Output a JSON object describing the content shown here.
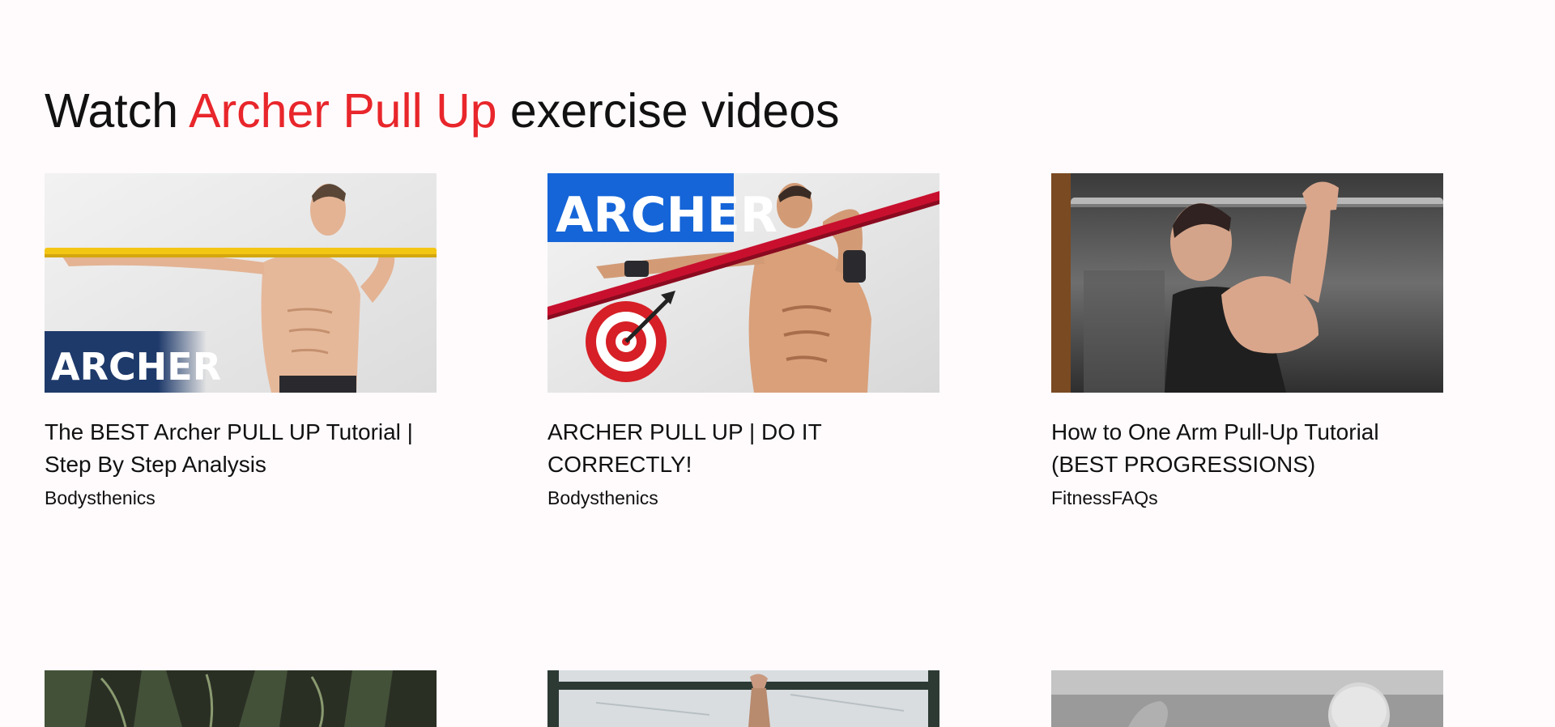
{
  "heading": {
    "prefix": "Watch ",
    "exercise": "Archer Pull Up",
    "suffix": " exercise videos"
  },
  "videos": [
    {
      "title": "The BEST Archer PULL UP Tutorial | Step By Step Analysis",
      "channel": "Bodysthenics",
      "thumbnail_text": "ARCHER"
    },
    {
      "title": "ARCHER PULL UP | DO IT CORRECTLY!",
      "channel": "Bodysthenics",
      "thumbnail_text": "ARCHER"
    },
    {
      "title": "How to One Arm Pull-Up Tutorial (BEST PROGRESSIONS)",
      "channel": "FitnessFAQs",
      "thumbnail_text": ""
    }
  ],
  "colors": {
    "accent": "#e8262b",
    "background": "#fffbfc"
  }
}
